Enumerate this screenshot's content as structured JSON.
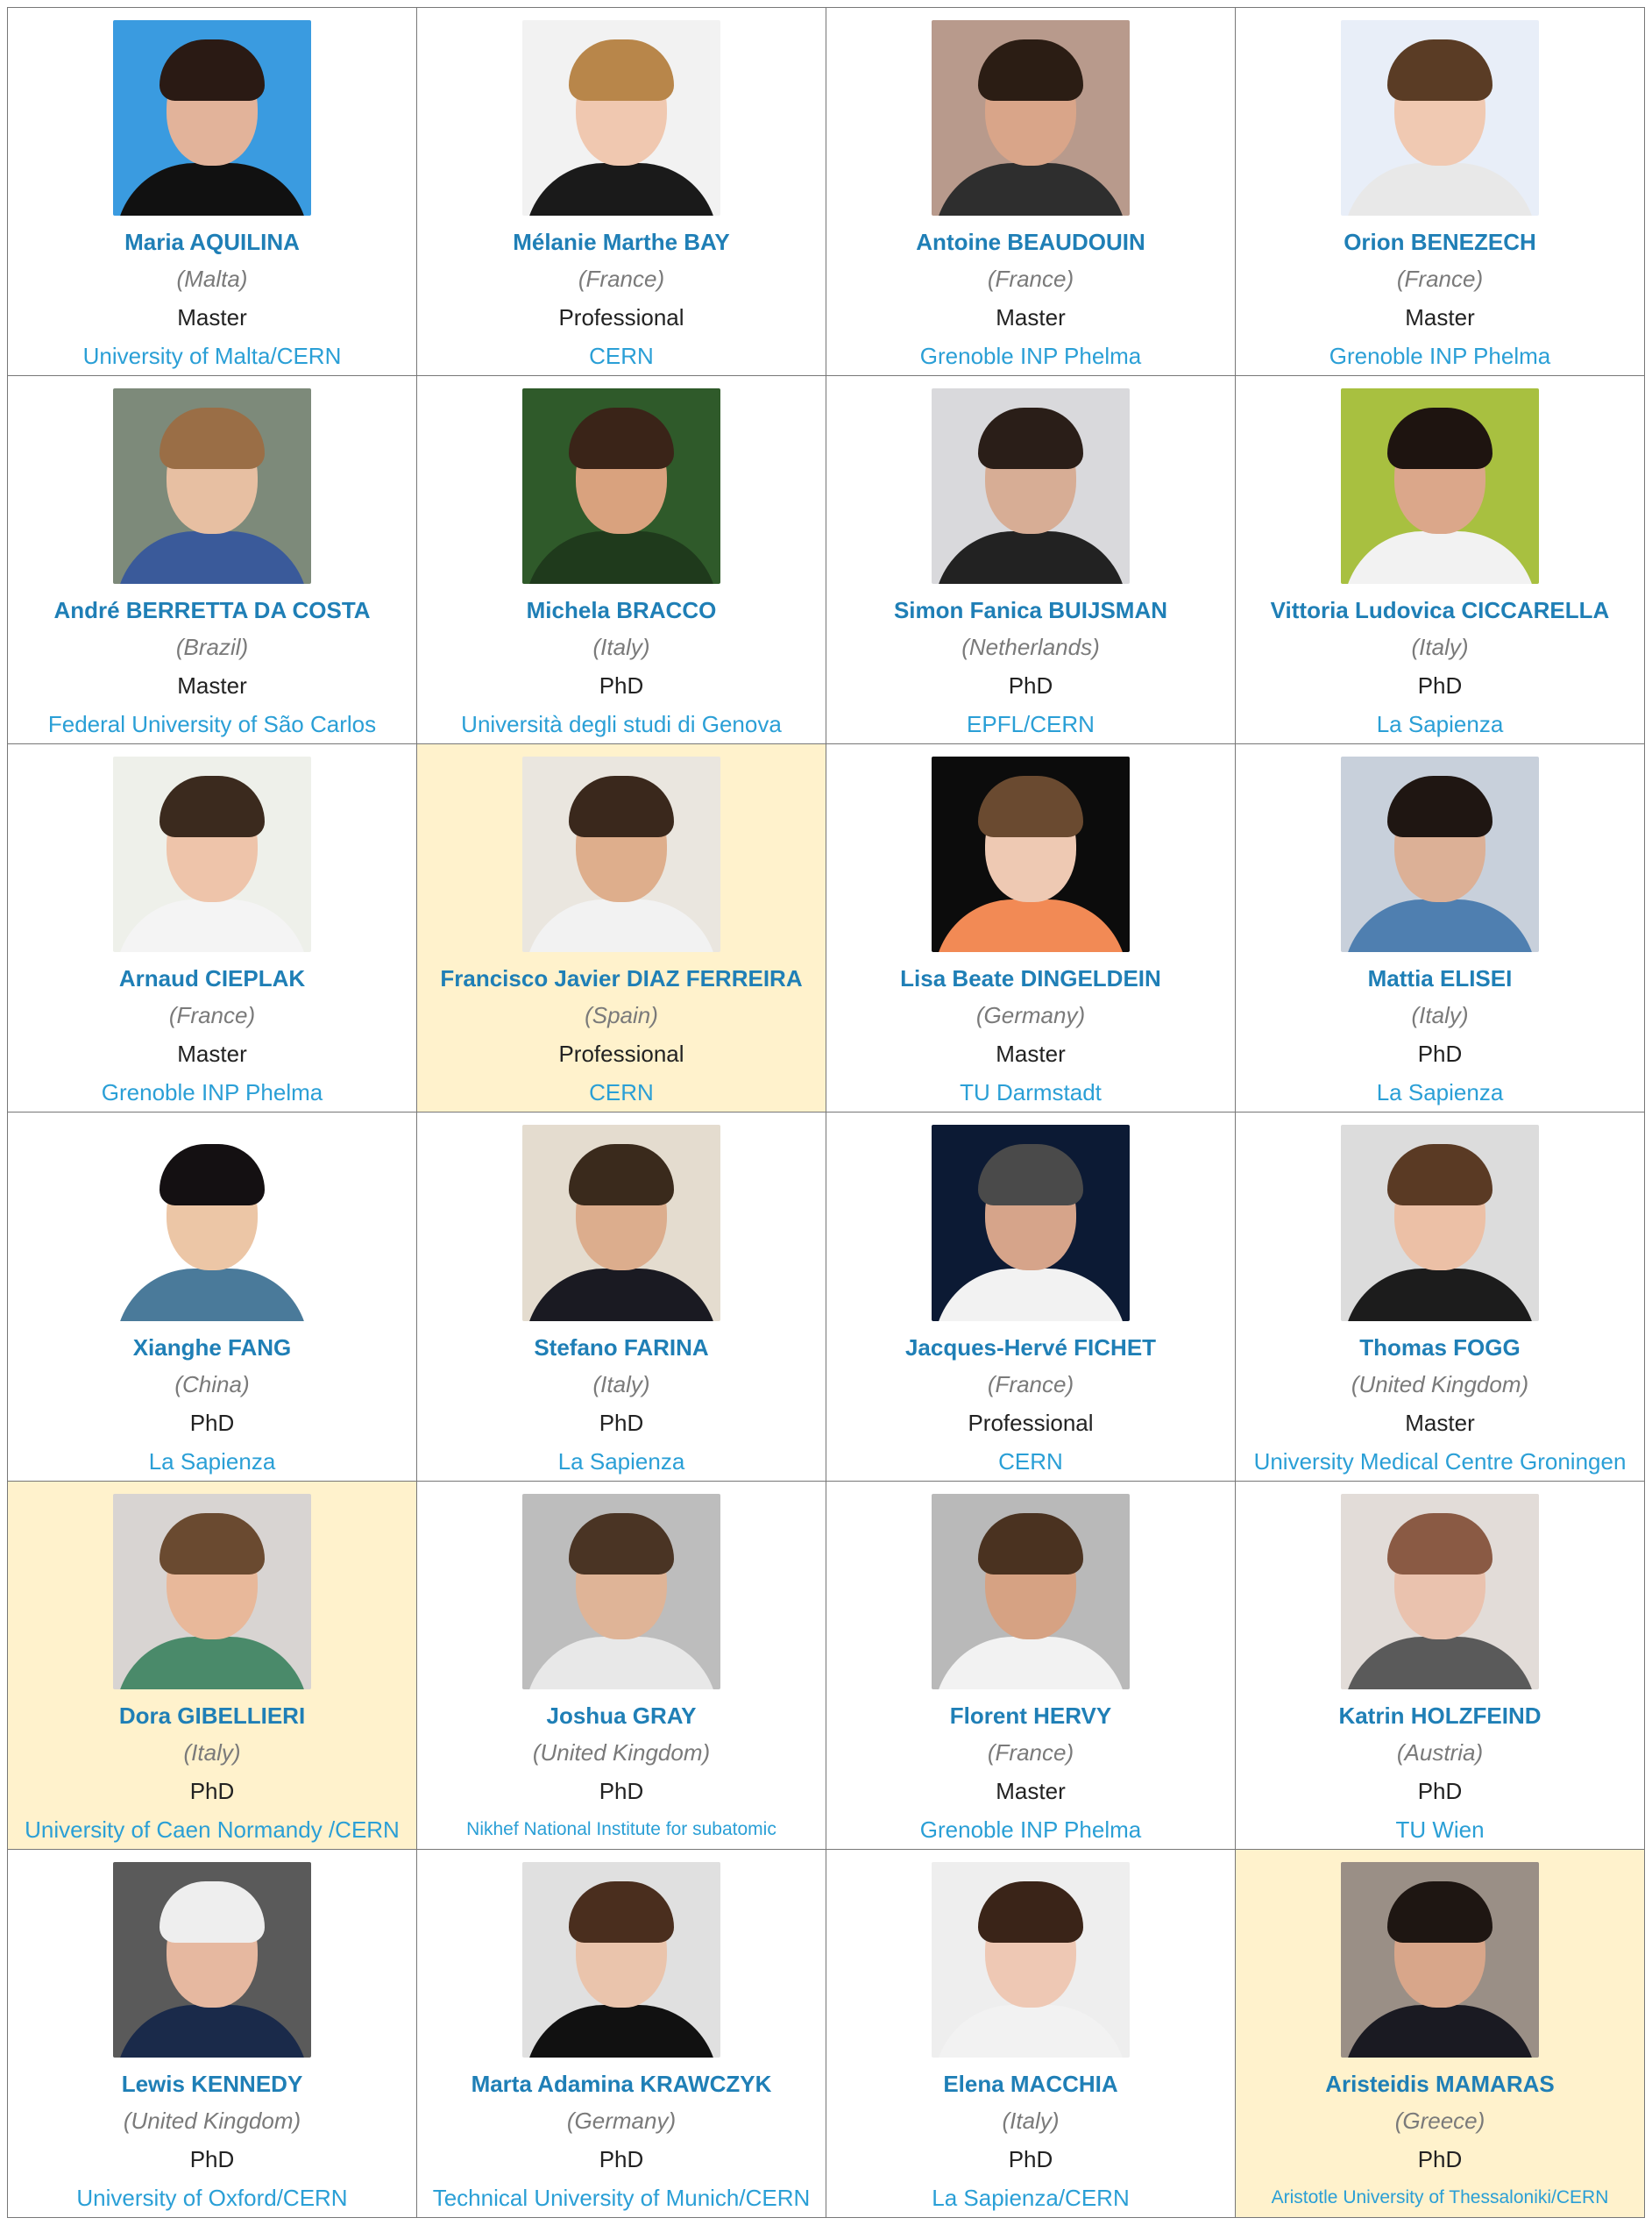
{
  "people": [
    {
      "name": "Maria AQUILINA",
      "country": "(Malta)",
      "level": "Master",
      "institution": "University of Malta/CERN",
      "highlight": false,
      "bg": "#3a9be0",
      "skin": "#e2b39a",
      "hair": "#2a1a14",
      "cloth": "#111111"
    },
    {
      "name": "Mélanie Marthe BAY",
      "country": "(France)",
      "level": "Professional",
      "institution": "CERN",
      "highlight": false,
      "bg": "#f2f2f2",
      "skin": "#f0c8b0",
      "hair": "#b8864a",
      "cloth": "#1a1a1a"
    },
    {
      "name": "Antoine BEAUDOUIN",
      "country": "(France)",
      "level": "Master",
      "institution": "Grenoble INP Phelma",
      "highlight": false,
      "bg": "#b89a8c",
      "skin": "#d9a589",
      "hair": "#2b1d14",
      "cloth": "#2e2e2e"
    },
    {
      "name": "Orion BENEZECH",
      "country": "(France)",
      "level": "Master",
      "institution": "Grenoble INP Phelma",
      "highlight": false,
      "bg": "#e8eef8",
      "skin": "#f0c9b2",
      "hair": "#5a3c25",
      "cloth": "#e8e8e8"
    },
    {
      "name": "André BERRETTA DA COSTA",
      "country": "(Brazil)",
      "level": "Master",
      "institution": "Federal University of São Carlos",
      "highlight": false,
      "bg": "#7d8a7a",
      "skin": "#e7bfa2",
      "hair": "#9a6e46",
      "cloth": "#3a5a9a"
    },
    {
      "name": "Michela BRACCO",
      "country": "(Italy)",
      "level": "PhD",
      "institution": "Università degli studi di Genova",
      "highlight": false,
      "bg": "#2f5a2a",
      "skin": "#d9a27e",
      "hair": "#3a2418",
      "cloth": "#1f3a1c"
    },
    {
      "name": "Simon Fanica BUIJSMAN",
      "country": "(Netherlands)",
      "level": "PhD",
      "institution": "EPFL/CERN",
      "highlight": false,
      "bg": "#d9d9dc",
      "skin": "#d7ad95",
      "hair": "#2a1e18",
      "cloth": "#222222"
    },
    {
      "name": "Vittoria Ludovica CICCARELLA",
      "country": "(Italy)",
      "level": "PhD",
      "institution": "La Sapienza",
      "highlight": false,
      "bg": "#a8c040",
      "skin": "#dba78a",
      "hair": "#1e1410",
      "cloth": "#f2f2f2"
    },
    {
      "name": "Arnaud CIEPLAK",
      "country": "(France)",
      "level": "Master",
      "institution": "Grenoble INP Phelma",
      "highlight": false,
      "bg": "#eef0ea",
      "skin": "#eec4aa",
      "hair": "#3b2a1e",
      "cloth": "#f4f4f4"
    },
    {
      "name": "Francisco Javier DIAZ FERREIRA",
      "country": "(Spain)",
      "level": "Professional",
      "institution": "CERN",
      "highlight": true,
      "bg": "#eae6df",
      "skin": "#deae8c",
      "hair": "#3a281c",
      "cloth": "#f2f2f2"
    },
    {
      "name": "Lisa Beate DINGELDEIN",
      "country": "(Germany)",
      "level": "Master",
      "institution": "TU Darmstadt",
      "highlight": false,
      "bg": "#0c0c0c",
      "skin": "#eec9b3",
      "hair": "#6a4a30",
      "cloth": "#f28a55"
    },
    {
      "name": "Mattia ELISEI",
      "country": "(Italy)",
      "level": "PhD",
      "institution": "La Sapienza",
      "highlight": false,
      "bg": "#c8d0db",
      "skin": "#dcb096",
      "hair": "#1f1612",
      "cloth": "#4f7fb0"
    },
    {
      "name": "Xianghe FANG",
      "country": "(China)",
      "level": "PhD",
      "institution": "La Sapienza",
      "highlight": false,
      "bg": "#ffffff",
      "skin": "#ecc6a6",
      "hair": "#141012",
      "cloth": "#4a7a9a"
    },
    {
      "name": "Stefano FARINA",
      "country": "(Italy)",
      "level": "PhD",
      "institution": "La Sapienza",
      "highlight": false,
      "bg": "#e4dccf",
      "skin": "#dcad8d",
      "hair": "#3a2a1c",
      "cloth": "#1a1a22"
    },
    {
      "name": "Jacques-Hervé FICHET",
      "country": "(France)",
      "level": "Professional",
      "institution": "CERN",
      "highlight": false,
      "bg": "#0c1a34",
      "skin": "#d6a48a",
      "hair": "#4a4a4a",
      "cloth": "#f2f2f2"
    },
    {
      "name": "Thomas FOGG",
      "country": "(United Kingdom)",
      "level": "Master",
      "institution": "University Medical Centre Groningen",
      "highlight": false,
      "bg": "#dcdcdc",
      "skin": "#ecc0a6",
      "hair": "#5a3a24",
      "cloth": "#1c1c1c"
    },
    {
      "name": "Dora GIBELLIERI",
      "country": "(Italy)",
      "level": "PhD",
      "institution": "University of Caen Normandy /CERN",
      "highlight": true,
      "bg": "#d8d4d2",
      "skin": "#e8b89a",
      "hair": "#6a4a30",
      "cloth": "#4a8a6a"
    },
    {
      "name": "Joshua GRAY",
      "country": "(United Kingdom)",
      "level": "PhD",
      "institution": "Nikhef National Institute for subatomic",
      "highlight": false,
      "small": true,
      "bg": "#bdbdbd",
      "skin": "#dfb497",
      "hair": "#4a3424",
      "cloth": "#e8e8e8"
    },
    {
      "name": "Florent HERVY",
      "country": "(France)",
      "level": "Master",
      "institution": "Grenoble INP Phelma",
      "highlight": false,
      "bg": "#b9b9b9",
      "skin": "#d6a283",
      "hair": "#4a3220",
      "cloth": "#f2f2f2"
    },
    {
      "name": "Katrin HOLZFEIND",
      "country": "(Austria)",
      "level": "PhD",
      "institution": "TU Wien",
      "highlight": false,
      "bg": "#e2dcd8",
      "skin": "#eac2ae",
      "hair": "#8a5a44",
      "cloth": "#5a5a5a"
    },
    {
      "name": "Lewis KENNEDY",
      "country": "(United Kingdom)",
      "level": "PhD",
      "institution": "University of Oxford/CERN",
      "highlight": false,
      "bg": "#5a5a5a",
      "skin": "#e6b8a0",
      "hair": "#eeeeee",
      "cloth": "#1a2a4a"
    },
    {
      "name": "Marta Adamina KRAWCZYK",
      "country": "(Germany)",
      "level": "PhD",
      "institution": "Technical University of Munich/CERN",
      "highlight": false,
      "bg": "#e0e0e0",
      "skin": "#eac4ac",
      "hair": "#4a2e1e",
      "cloth": "#111111"
    },
    {
      "name": "Elena MACCHIA",
      "country": "(Italy)",
      "level": "PhD",
      "institution": "La Sapienza/CERN",
      "highlight": false,
      "bg": "#eeeeee",
      "skin": "#eec8b4",
      "hair": "#3a2418",
      "cloth": "#f2f2f2"
    },
    {
      "name": "Aristeidis MAMARAS",
      "country": "(Greece)",
      "level": "PhD",
      "institution": "Aristotle University of Thessaloniki/CERN",
      "highlight": true,
      "small": true,
      "bg": "#9a8f86",
      "skin": "#d8a68a",
      "hair": "#1e1612",
      "cloth": "#1a1a22"
    }
  ]
}
